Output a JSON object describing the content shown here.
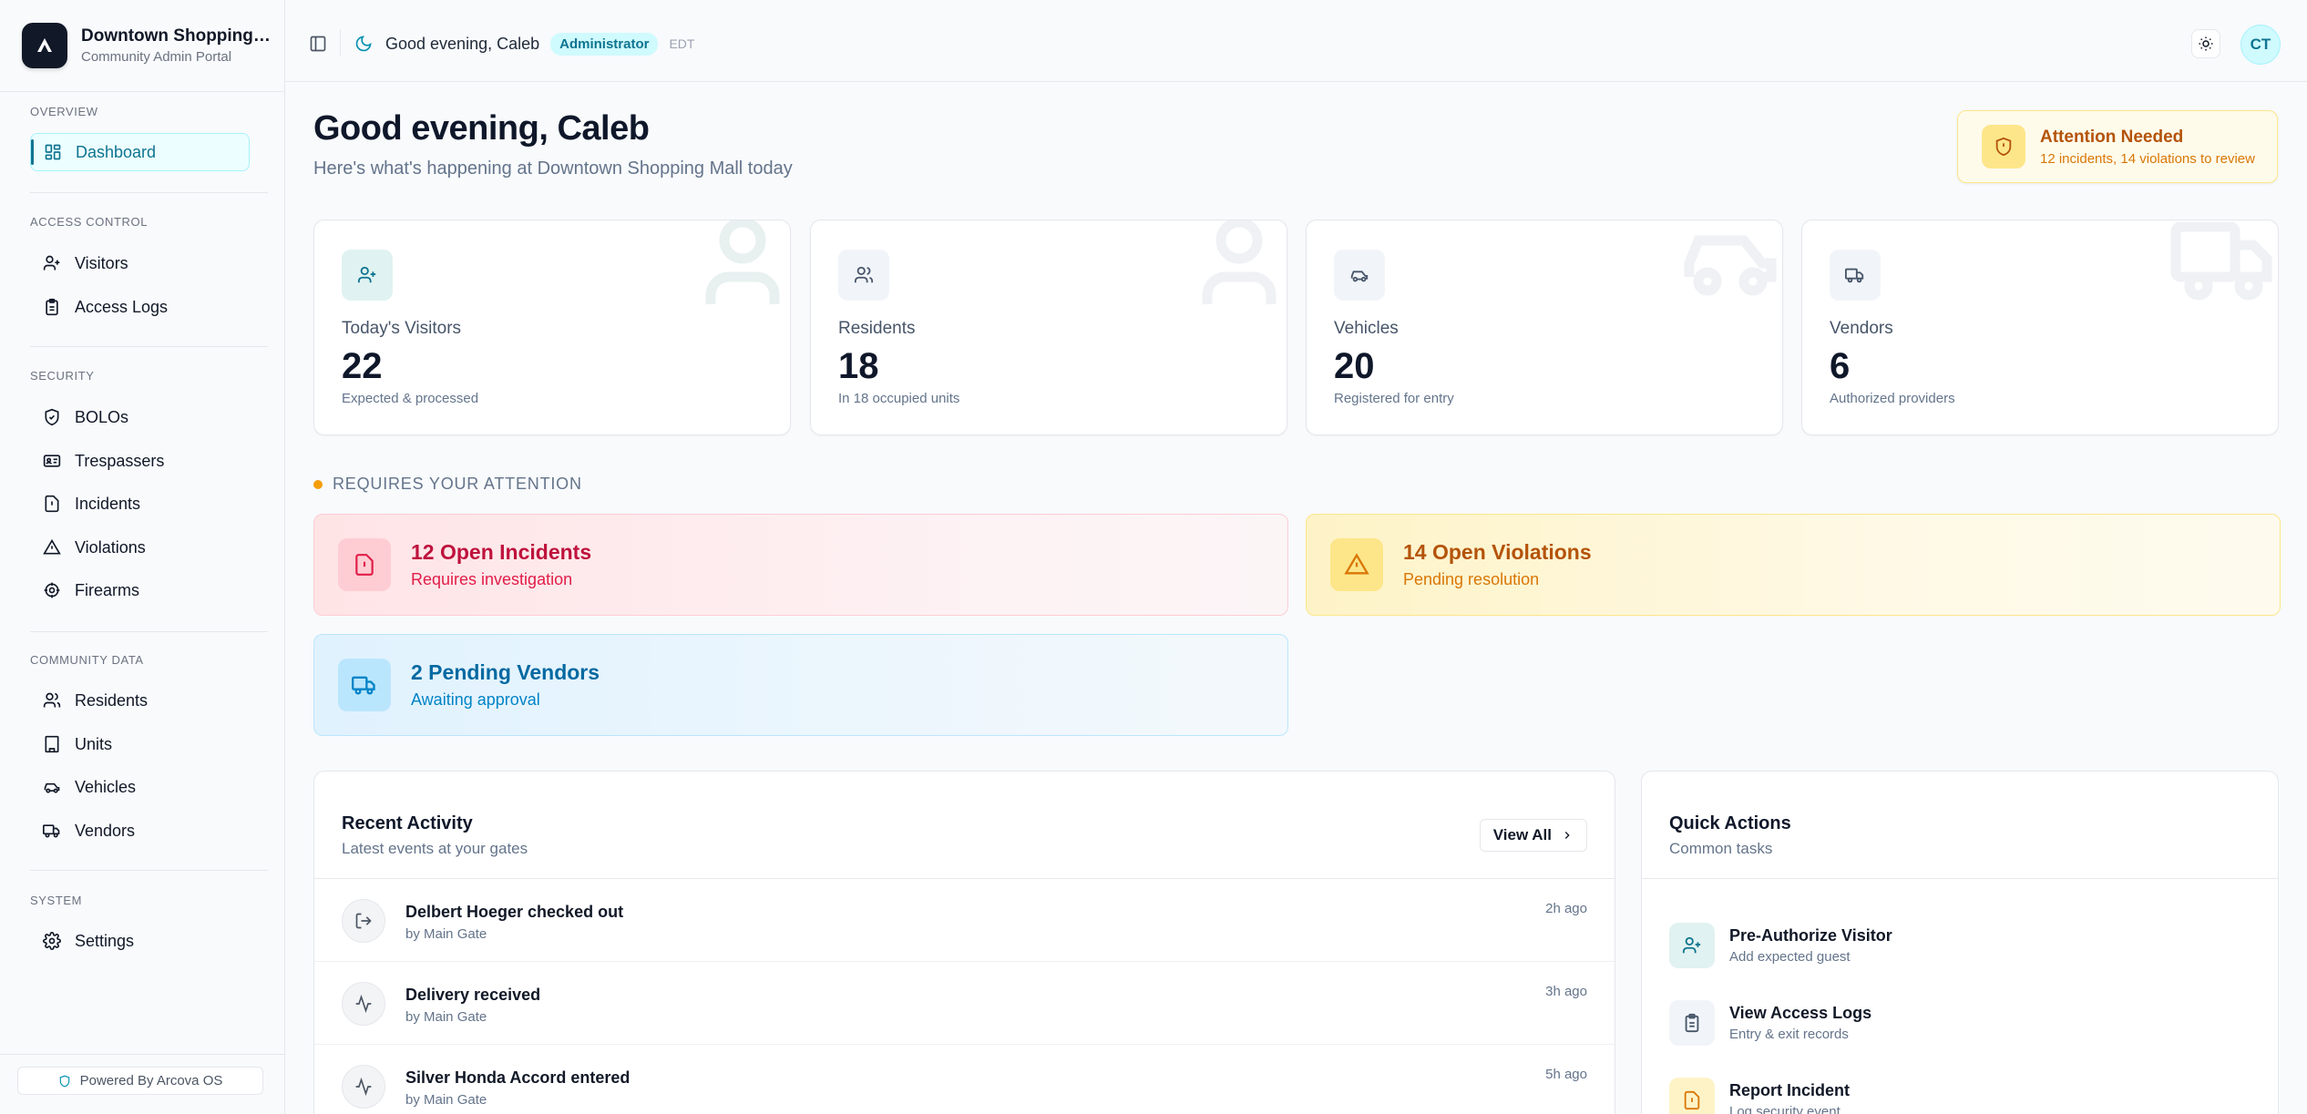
{
  "brand": {
    "name": "Downtown Shopping Mall",
    "subtitle": "Community Admin Portal",
    "logo_icon": "arcova-logo-icon"
  },
  "sidebar": {
    "sections": [
      {
        "label": "OVERVIEW",
        "items": [
          {
            "label": "Dashboard",
            "icon": "grid-icon",
            "active": true
          }
        ]
      },
      {
        "label": "ACCESS CONTROL",
        "items": [
          {
            "label": "Visitors",
            "icon": "user-plus-icon"
          },
          {
            "label": "Access Logs",
            "icon": "clipboard-icon"
          }
        ]
      },
      {
        "label": "SECURITY",
        "items": [
          {
            "label": "BOLOs",
            "icon": "shield-check-icon"
          },
          {
            "label": "Trespassers",
            "icon": "id-card-icon"
          },
          {
            "label": "Incidents",
            "icon": "file-alert-icon"
          },
          {
            "label": "Violations",
            "icon": "triangle-alert-icon"
          },
          {
            "label": "Firearms",
            "icon": "target-icon"
          }
        ]
      },
      {
        "label": "COMMUNITY DATA",
        "items": [
          {
            "label": "Residents",
            "icon": "users-icon"
          },
          {
            "label": "Units",
            "icon": "building-icon"
          },
          {
            "label": "Vehicles",
            "icon": "car-icon"
          },
          {
            "label": "Vendors",
            "icon": "truck-icon"
          }
        ]
      },
      {
        "label": "SYSTEM",
        "items": [
          {
            "label": "Settings",
            "icon": "gear-icon"
          }
        ]
      }
    ],
    "powered_by": "Powered By Arcova OS"
  },
  "topbar": {
    "greeting": "Good evening, Caleb",
    "role": "Administrator",
    "timezone": "EDT",
    "avatar_initials": "CT"
  },
  "header": {
    "title": "Good evening, Caleb",
    "subtitle": "Here's what's happening at Downtown Shopping Mall today"
  },
  "attention": {
    "title": "Attention Needed",
    "subtitle": "12 incidents, 14 violations to review"
  },
  "stats": [
    {
      "label": "Today's Visitors",
      "value": "22",
      "desc": "Expected & processed",
      "icon": "user-plus-icon"
    },
    {
      "label": "Residents",
      "value": "18",
      "desc": "In 18 occupied units",
      "icon": "users-icon"
    },
    {
      "label": "Vehicles",
      "value": "20",
      "desc": "Registered for entry",
      "icon": "car-icon"
    },
    {
      "label": "Vendors",
      "value": "6",
      "desc": "Authorized providers",
      "icon": "truck-icon"
    }
  ],
  "requires_attention": {
    "heading": "REQUIRES YOUR ATTENTION",
    "cards": [
      {
        "title": "12 Open Incidents",
        "subtitle": "Requires investigation",
        "icon": "file-alert-icon"
      },
      {
        "title": "14 Open Violations",
        "subtitle": "Pending resolution",
        "icon": "triangle-alert-icon"
      },
      {
        "title": "2 Pending Vendors",
        "subtitle": "Awaiting approval",
        "icon": "truck-icon"
      }
    ]
  },
  "recent_activity": {
    "title": "Recent Activity",
    "subtitle": "Latest events at your gates",
    "view_all_label": "View All",
    "items": [
      {
        "title": "Delbert Hoeger checked out",
        "by": "by Main Gate",
        "time": "2h ago",
        "icon": "log-out-icon"
      },
      {
        "title": "Delivery received",
        "by": "by Main Gate",
        "time": "3h ago",
        "icon": "activity-icon"
      },
      {
        "title": "Silver Honda Accord entered",
        "by": "by Main Gate",
        "time": "5h ago",
        "icon": "activity-icon"
      }
    ]
  },
  "quick_actions": {
    "title": "Quick Actions",
    "subtitle": "Common tasks",
    "items": [
      {
        "title": "Pre-Authorize Visitor",
        "subtitle": "Add expected guest",
        "icon": "user-plus-icon"
      },
      {
        "title": "View Access Logs",
        "subtitle": "Entry & exit records",
        "icon": "clipboard-icon"
      },
      {
        "title": "Report Incident",
        "subtitle": "Log security event",
        "icon": "file-alert-icon"
      }
    ]
  },
  "colors": {
    "accent": "#0e7490",
    "accent_light": "#ecfeff",
    "danger": "#be123c",
    "warning": "#b45309",
    "info": "#0369a1"
  }
}
